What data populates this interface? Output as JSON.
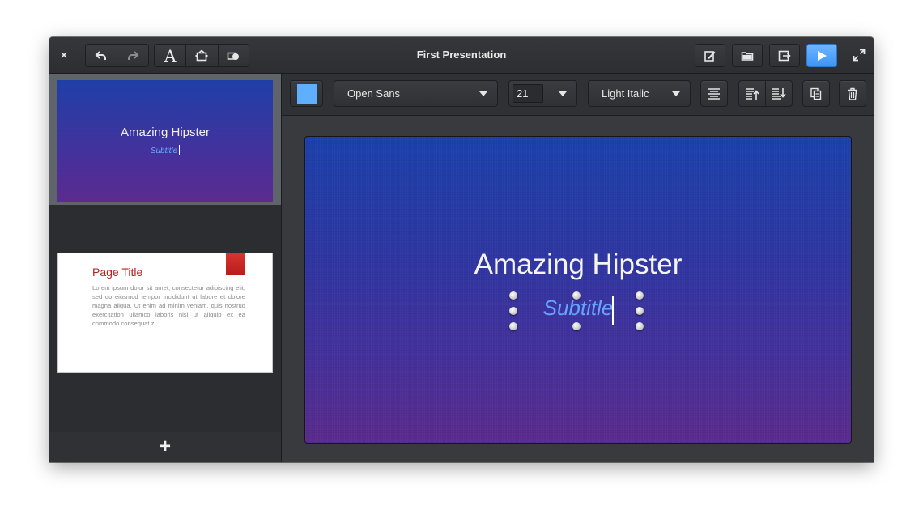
{
  "window": {
    "title": "First Presentation",
    "close_glyph": "×"
  },
  "header": {
    "left_tools": [
      "undo-icon",
      "redo-icon",
      "text-icon",
      "image-icon",
      "shape-icon"
    ],
    "text_tool_glyph": "A",
    "right_tools": [
      "edit-icon",
      "folder-icon",
      "export-icon",
      "play-icon",
      "fullscreen-icon"
    ]
  },
  "sidebar": {
    "slides": [
      {
        "title": "Amazing Hipster",
        "subtitle": "Subtitle",
        "selected": true
      },
      {
        "title": "Page Title",
        "body": "Lorem ipsum dolor sit amet, consectetur adipiscing elit, sed do eiusmod tempor incididunt ut labore et dolore magna aliqua. Ut enim ad minim veniam, quis nostrud exercitation ullamco laboris nisi ut aliquip ex ea commodo consequat z",
        "selected": false
      }
    ],
    "add_glyph": "+"
  },
  "toolbar": {
    "color": "#5eb0ff",
    "font_family": "Open Sans",
    "font_size": "21",
    "font_style": "Light Italic"
  },
  "canvas": {
    "title": "Amazing Hipster",
    "subtitle": "Subtitle"
  },
  "colors": {
    "accent": "#3d94f5",
    "slide_top": "#1b41ab",
    "slide_bottom": "#5a2b8c",
    "subtitle": "#66a3ff",
    "page_title": "#b3201f"
  }
}
